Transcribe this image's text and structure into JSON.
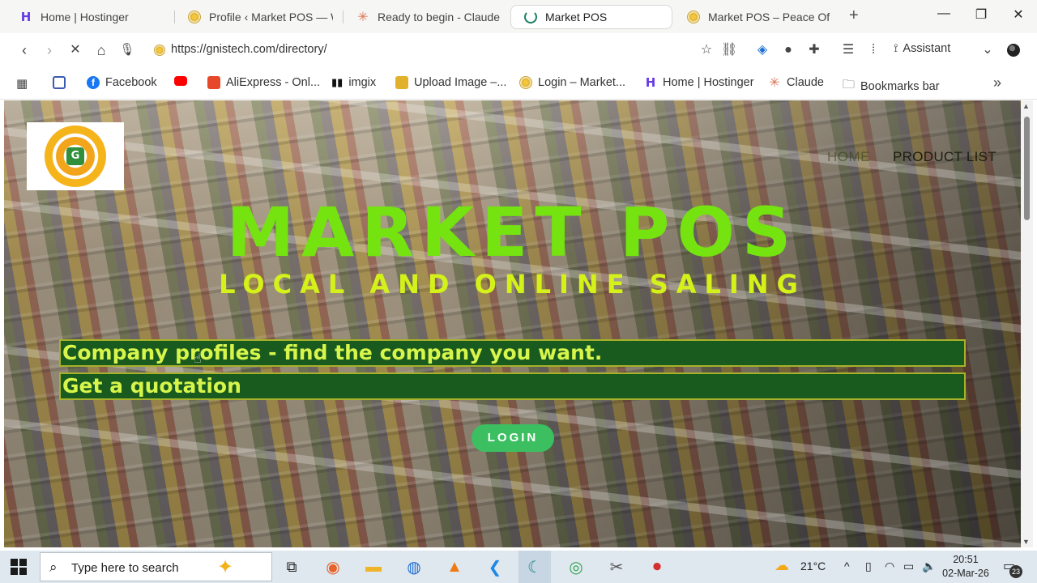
{
  "browser": {
    "tabs": [
      {
        "title": "Home | Hostinger",
        "icon": "hostinger-icon",
        "active": false
      },
      {
        "title": "Profile ‹ Market POS — W",
        "icon": "market-pos-icon",
        "active": false
      },
      {
        "title": "Ready to begin - Claude",
        "icon": "claude-icon",
        "active": false
      },
      {
        "title": "Market POS",
        "icon": "loading-spinner-icon",
        "active": true
      },
      {
        "title": "Market POS – Peace Of M",
        "icon": "market-pos-icon",
        "active": false
      }
    ],
    "url": "https://gnistech.com/directory/",
    "assistant_label": "Assistant",
    "bookmarks": [
      {
        "label": "",
        "icon": "apps-grid-icon"
      },
      {
        "label": "",
        "icon": "calendar-icon"
      },
      {
        "label": "Facebook",
        "icon": "facebook-icon"
      },
      {
        "label": "",
        "icon": "youtube-icon"
      },
      {
        "label": "AliExpress - Onl...",
        "icon": "aliexpress-icon"
      },
      {
        "label": "imgix",
        "icon": "imgix-icon"
      },
      {
        "label": "Upload Image –...",
        "icon": "upload-image-icon"
      },
      {
        "label": "Login – Market...",
        "icon": "market-pos-icon"
      },
      {
        "label": "Home | Hostinger",
        "icon": "hostinger-icon"
      },
      {
        "label": "Claude",
        "icon": "claude-icon"
      },
      {
        "label": "Bookmarks bar",
        "icon": "folder-icon"
      }
    ]
  },
  "page": {
    "nav": {
      "home": "HOME",
      "products": "PRODUCT LIST"
    },
    "hero_title": "MARKET POS",
    "hero_subtitle": "LOCAL AND ONLINE SALING",
    "banners": [
      "Company profiles - find the company you want.",
      "Get a quotation"
    ],
    "login_label": "LOGIN",
    "colors": {
      "title": "#74e30f",
      "subtitle": "#d4f21a",
      "banner_bg": "#195a1f",
      "banner_text": "#d7f54a",
      "login_bg": "#3bbf61"
    }
  },
  "taskbar": {
    "search_placeholder": "Type here to search",
    "temperature": "21°C",
    "time": "20:51",
    "date": "02-Mar-26",
    "notification_count": "23"
  }
}
